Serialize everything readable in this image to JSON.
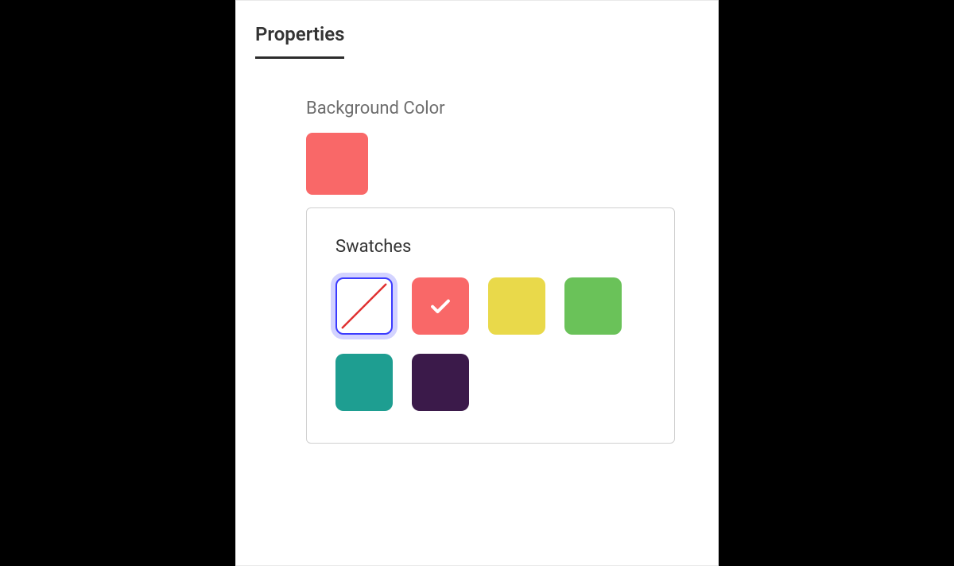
{
  "tabs": {
    "properties": "Properties"
  },
  "field": {
    "label": "Background Color",
    "current_color": "#f96868"
  },
  "popover": {
    "title": "Swatches",
    "swatches": [
      {
        "name": "none",
        "color": "none",
        "focused": true,
        "selected": false
      },
      {
        "name": "coral",
        "color": "#f96868",
        "focused": false,
        "selected": true
      },
      {
        "name": "yellow",
        "color": "#e9d94a",
        "focused": false,
        "selected": false
      },
      {
        "name": "green",
        "color": "#6ac259",
        "focused": false,
        "selected": false
      },
      {
        "name": "teal",
        "color": "#1e9e91",
        "focused": false,
        "selected": false
      },
      {
        "name": "purple",
        "color": "#3b1a4a",
        "focused": false,
        "selected": false
      }
    ]
  }
}
